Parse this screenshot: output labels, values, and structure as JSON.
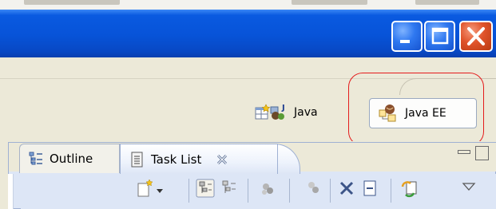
{
  "window": {
    "title_bar_controls": [
      "minimize-button",
      "maximize-button",
      "close-button"
    ]
  },
  "perspectives": {
    "open_perspective_icon": "open-perspective-icon",
    "items": [
      {
        "label": "Java",
        "icon": "java-perspective-icon",
        "selected": false
      },
      {
        "label": "Java EE",
        "icon": "java-ee-perspective-icon",
        "selected": true
      }
    ]
  },
  "views": {
    "tabs": [
      {
        "label": "Outline",
        "icon": "outline-icon",
        "active": false
      },
      {
        "label": "Task List",
        "icon": "task-list-icon",
        "active": true
      }
    ],
    "view_controls": [
      "minimize-view-button",
      "maximize-view-button"
    ],
    "toolbar_icons": [
      "new-task-icon",
      "dropdown-arrow-icon",
      "categorized-icon",
      "scheduled-icon",
      "hide-completed-icon",
      "hide-non-matching-icon",
      "remove-icon",
      "collapse-all-icon",
      "synchronize-icon",
      "view-menu-icon"
    ]
  },
  "colors": {
    "titlebar_blue": "#0753d8",
    "close_red": "#e0532a",
    "highlight_red": "#e41b1b",
    "panel_blue": "#dde6f6",
    "chrome": "#ECE9D8"
  }
}
